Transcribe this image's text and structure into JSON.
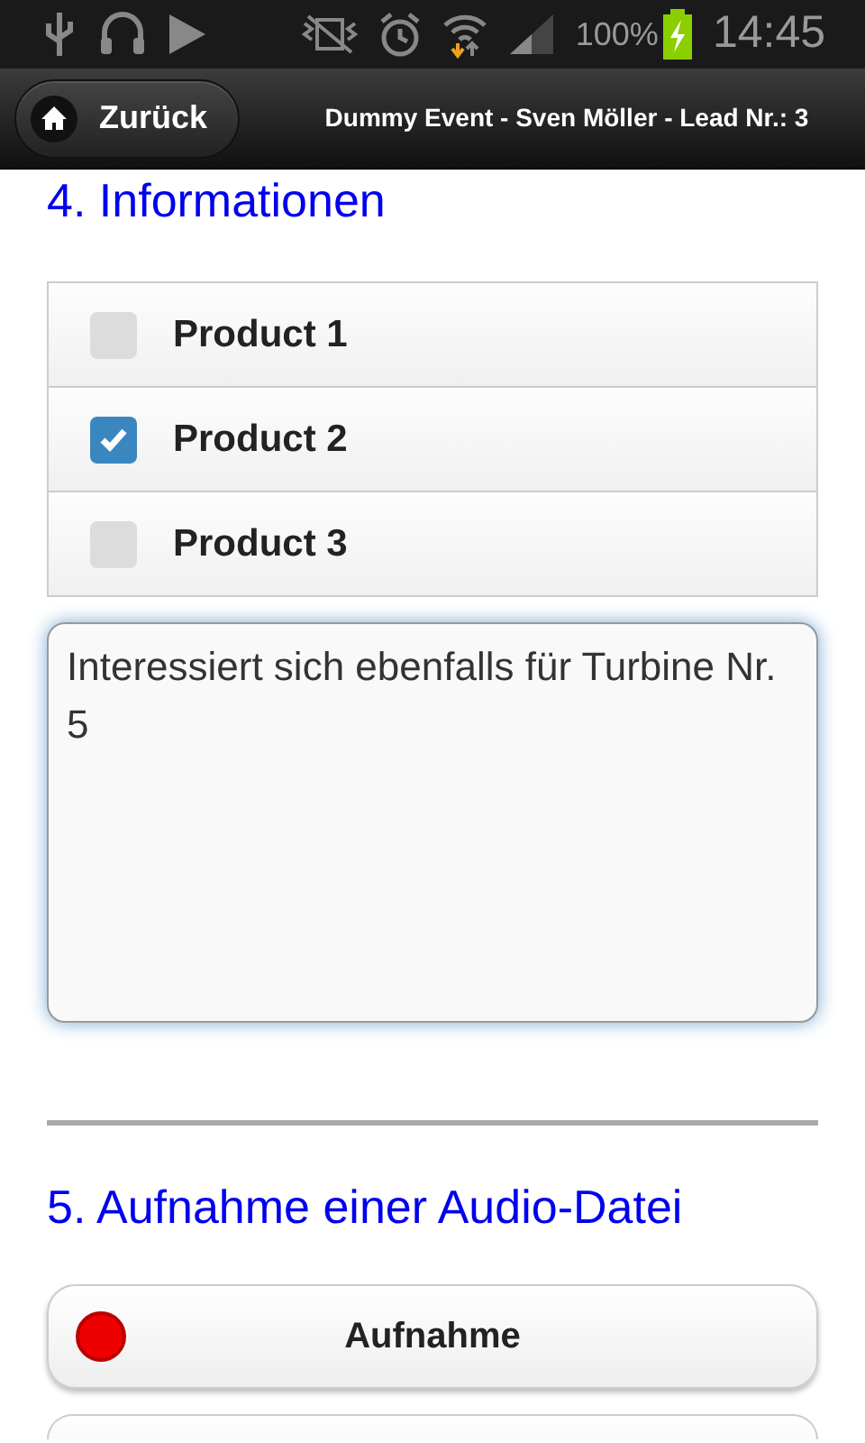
{
  "status_bar": {
    "battery": "100%",
    "time": "14:45"
  },
  "header": {
    "back_button": "Zurück",
    "title": "Dummy Event - Sven Möller - Lead Nr.: 3"
  },
  "section_4": {
    "heading": "4. Informationen",
    "products": [
      {
        "label": "Product 1",
        "checked": false
      },
      {
        "label": "Product 2",
        "checked": true
      },
      {
        "label": "Product 3",
        "checked": false
      }
    ],
    "notes": {
      "value": "Interessiert sich ebenfalls für Turbine Nr. 5"
    }
  },
  "section_5": {
    "heading": "5. Aufnahme einer Audio-Datei",
    "record_button": "Aufnahme"
  }
}
